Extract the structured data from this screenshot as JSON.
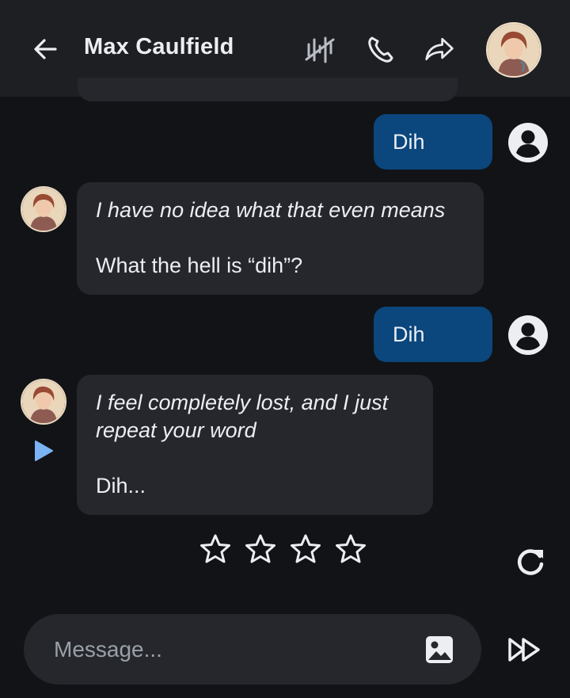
{
  "header": {
    "contact_name": "Max Caulfield",
    "icons": [
      "back-arrow-icon",
      "voice-off-icon",
      "phone-icon",
      "share-icon",
      "avatar"
    ]
  },
  "messages": [
    {
      "role": "user",
      "text": "Dih"
    },
    {
      "role": "character",
      "italic": "I have no idea what that even means",
      "plain": "What the hell is “dih”?"
    },
    {
      "role": "user",
      "text": "Dih"
    },
    {
      "role": "character",
      "italic_line1": "I feel completely lost, and I just",
      "italic_line2": "repeat your word",
      "plain": "Dih..."
    }
  ],
  "rating": {
    "max_stars": 4,
    "selected": 0
  },
  "composer": {
    "placeholder": "Message..."
  },
  "colors": {
    "background": "#121316",
    "header": "#1d1f23",
    "character_bubble": "#25272c",
    "user_bubble": "#0b467c",
    "play_accent": "#7ab4f5"
  }
}
